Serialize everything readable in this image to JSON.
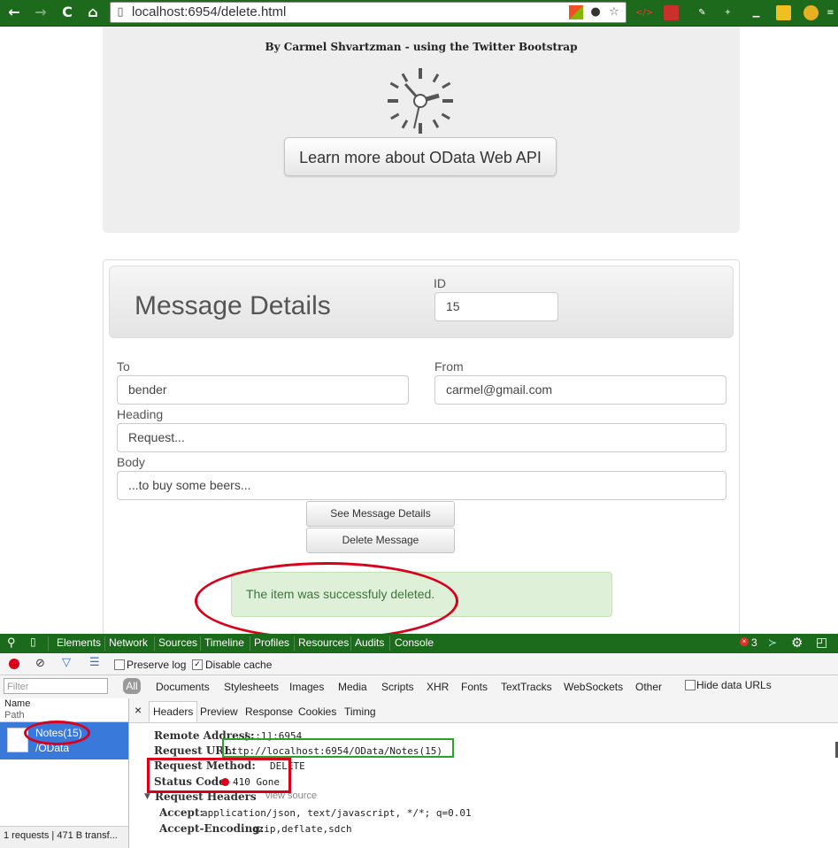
{
  "browser": {
    "url": "localhost:6954/delete.html",
    "nav": {
      "back": "←",
      "forward": "→",
      "reload": "C",
      "home": "⌂"
    }
  },
  "hero": {
    "byline": "By Carmel Shvartzman - using the Twitter Bootstrap",
    "learn_button": "Learn more about OData Web API"
  },
  "form": {
    "title": "Message Details",
    "id_label": "ID",
    "id_value": "15",
    "to_label": "To",
    "to_value": "bender",
    "from_label": "From",
    "from_value": "carmel@gmail.com",
    "heading_label": "Heading",
    "heading_value": "Request...",
    "body_label": "Body",
    "body_value": "...to buy some beers...",
    "see_button": "See Message Details",
    "delete_button": "Delete Message",
    "alert": "The item was successfuly deleted."
  },
  "devtools": {
    "tabs": [
      "Elements",
      "Network",
      "Sources",
      "Timeline",
      "Profiles",
      "Resources",
      "Audits",
      "Console"
    ],
    "error_count": "3",
    "preserve_log": "Preserve log",
    "disable_cache": "Disable cache",
    "filter_placeholder": "Filter",
    "filter_all": "All",
    "filters": [
      "Documents",
      "Stylesheets",
      "Images",
      "Media",
      "Scripts",
      "XHR",
      "Fonts",
      "TextTracks",
      "WebSockets",
      "Other"
    ],
    "hide_data_urls": "Hide data URLs",
    "col_name": "Name",
    "col_path": "Path",
    "request_name": "Notes(15)",
    "request_path": "/OData",
    "footer": "1 requests | 471 B transf...",
    "detail_tabs": [
      "Headers",
      "Preview",
      "Response",
      "Cookies",
      "Timing"
    ],
    "close": "×",
    "headers": {
      "remote_address_key": "Remote Address:",
      "remote_address": "[::1]:6954",
      "request_url_key": "Request URL:",
      "request_url": "http://localhost:6954/OData/Notes(15)",
      "request_method_key": "Request Method:",
      "request_method": "DELETE",
      "status_code_key": "Status Code:",
      "status_code": "410 Gone",
      "request_headers_key": "Request Headers",
      "view_source": "view source",
      "accept_key": "Accept:",
      "accept": "application/json, text/javascript, */*; q=0.01",
      "accept_encoding_key": "Accept-Encoding:",
      "accept_encoding": "gzip,deflate,sdch"
    }
  },
  "colors": {
    "chrome_green": "#1d6a1d",
    "alert_bg": "#dff0d8",
    "annotation_red": "#d9001b",
    "annotation_green": "#2aa32a",
    "selected_row": "#3879d9"
  },
  "icons": {
    "back": "back-arrow-icon",
    "forward": "forward-arrow-icon",
    "reload": "reload-icon",
    "home": "home-icon",
    "star": "bookmark-star-icon",
    "clock": "clock-icon",
    "record": "record-icon",
    "clear": "clear-icon",
    "filter": "filter-icon",
    "settings": "gear-icon"
  }
}
